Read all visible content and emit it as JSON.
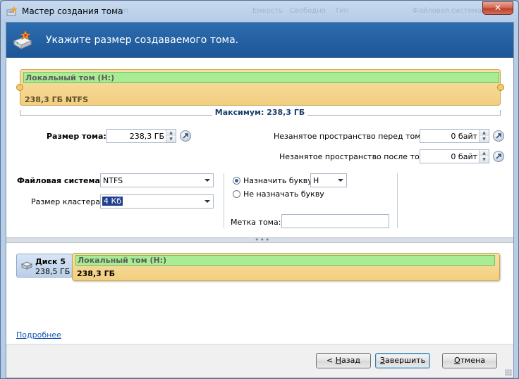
{
  "window": {
    "title": "Мастер создания тома",
    "ghost_texts": [
      "Тип",
      "Емкость",
      "Свободно",
      "Тип",
      "Файловая система"
    ],
    "close_label": "✕"
  },
  "header": {
    "heading": "Укажите размер создаваемого тома."
  },
  "volume_bar": {
    "name": "Локальный том (H:)",
    "size_label": "238,3 ГБ NTFS",
    "maximum_label": "Максимум: 238,3 ГБ"
  },
  "form": {
    "volume_size_label": "Размер тома:",
    "volume_size_value": "238,3 ГБ",
    "space_before_label": "Незанятое пространство перед томом:",
    "space_before_value": "0 байт",
    "space_after_label": "Незанятое пространство после тома:",
    "space_after_value": "0 байт",
    "filesystem_label": "Файловая система:",
    "filesystem_value": "NTFS",
    "cluster_label": "Размер кластера:",
    "cluster_value": "4 Кб",
    "assign_letter_label": "Назначить букву:",
    "letter_value": "H",
    "no_letter_label": "Не назначать букву",
    "volume_label_label": "Метка тома:",
    "volume_label_value": ""
  },
  "disk_map": {
    "disk_name": "Диск 5",
    "disk_size": "238,5 ГБ",
    "partition_name": "Локальный том (H:)",
    "partition_size": "238,3 ГБ"
  },
  "links": {
    "details": "Подробнее"
  },
  "buttons": {
    "back_prefix": "< ",
    "back_hotkey": "Н",
    "back_rest": "азад",
    "finish_prefix": "",
    "finish_hotkey": "З",
    "finish_rest": "авершить",
    "cancel_prefix": "",
    "cancel_hotkey": "О",
    "cancel_rest": "тмена"
  },
  "colors": {
    "header_band": "#1c5595",
    "volume_fill": "#f2cf80",
    "volume_label_fill": "#a8ec93",
    "link": "#1a56b3"
  }
}
